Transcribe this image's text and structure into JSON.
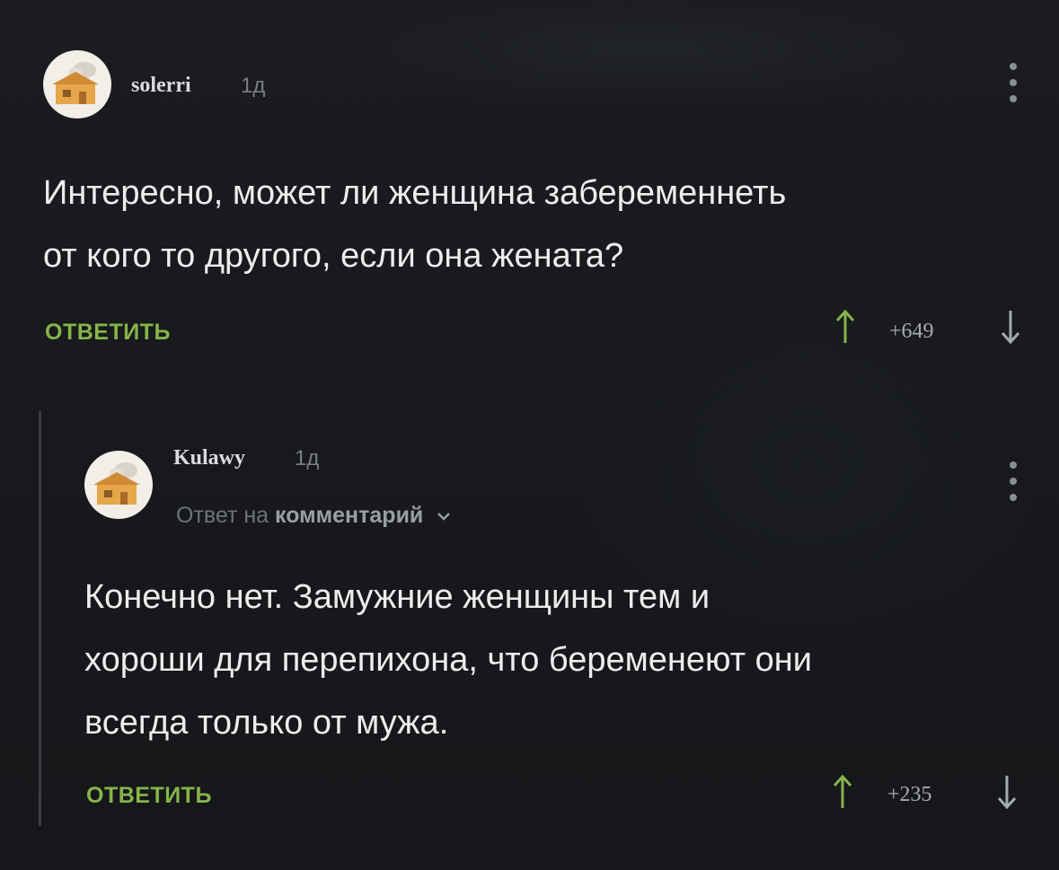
{
  "colors": {
    "background": "#17191d",
    "accent_green": "#86b44a",
    "text_primary": "#eceded",
    "text_muted": "#7a7d82"
  },
  "comments": [
    {
      "author": "solerri",
      "time": "1д",
      "avatar_icon": "house-avatar-icon",
      "body_lines": [
        "Интересно, может ли женщина забеременнеть",
        "от кого то другого, если она жената?"
      ],
      "reply_label": "ОТВЕТИТЬ",
      "score": "+649"
    },
    {
      "author": "Kulawy",
      "time": "1д",
      "avatar_icon": "house-avatar-icon",
      "reply_to_prefix": "Ответ на",
      "reply_to_link": "комментарий",
      "body_lines": [
        "Конечно нет. Замужние женщины тем и",
        "хороши для перепихона, что беременеют они",
        "всегда только от мужа."
      ],
      "reply_label": "ОТВЕТИТЬ",
      "score": "+235"
    }
  ]
}
